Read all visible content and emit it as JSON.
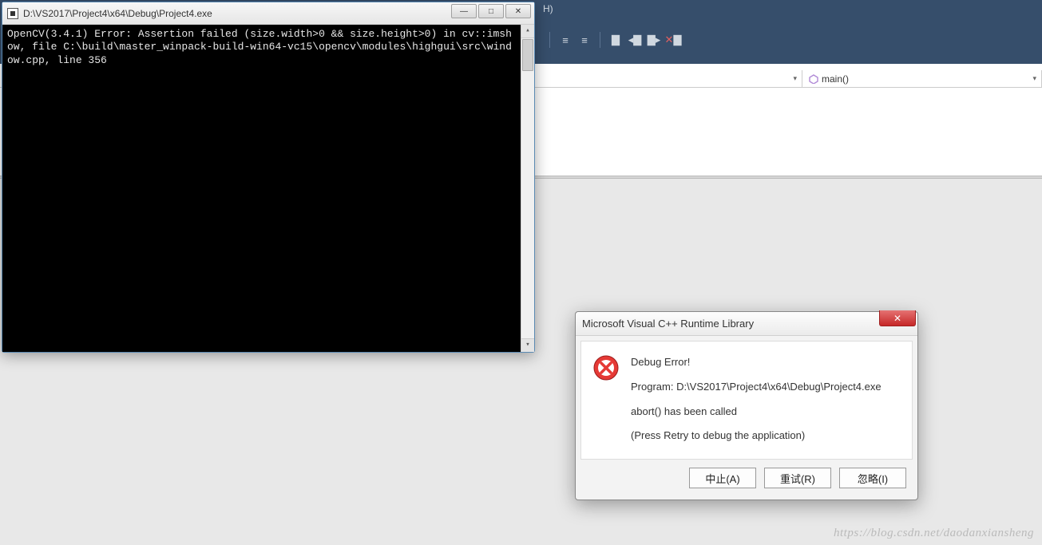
{
  "vs": {
    "toolbar_hint": "H)",
    "nav": {
      "scope_symbol": "main()"
    }
  },
  "console": {
    "title": "D:\\VS2017\\Project4\\x64\\Debug\\Project4.exe",
    "output": "OpenCV(3.4.1) Error: Assertion failed (size.width>0 && size.height>0) in cv::imshow, file C:\\build\\master_winpack-build-win64-vc15\\opencv\\modules\\highgui\\src\\window.cpp, line 356"
  },
  "dialog": {
    "title": "Microsoft Visual C++ Runtime Library",
    "heading": "Debug Error!",
    "program_line": "Program: D:\\VS2017\\Project4\\x64\\Debug\\Project4.exe",
    "message": "abort() has been called",
    "hint": "(Press Retry to debug the application)",
    "buttons": {
      "abort": "中止(A)",
      "retry": "重试(R)",
      "ignore": "忽略(I)"
    }
  },
  "watermark": "https://blog.csdn.net/daodanxiansheng"
}
